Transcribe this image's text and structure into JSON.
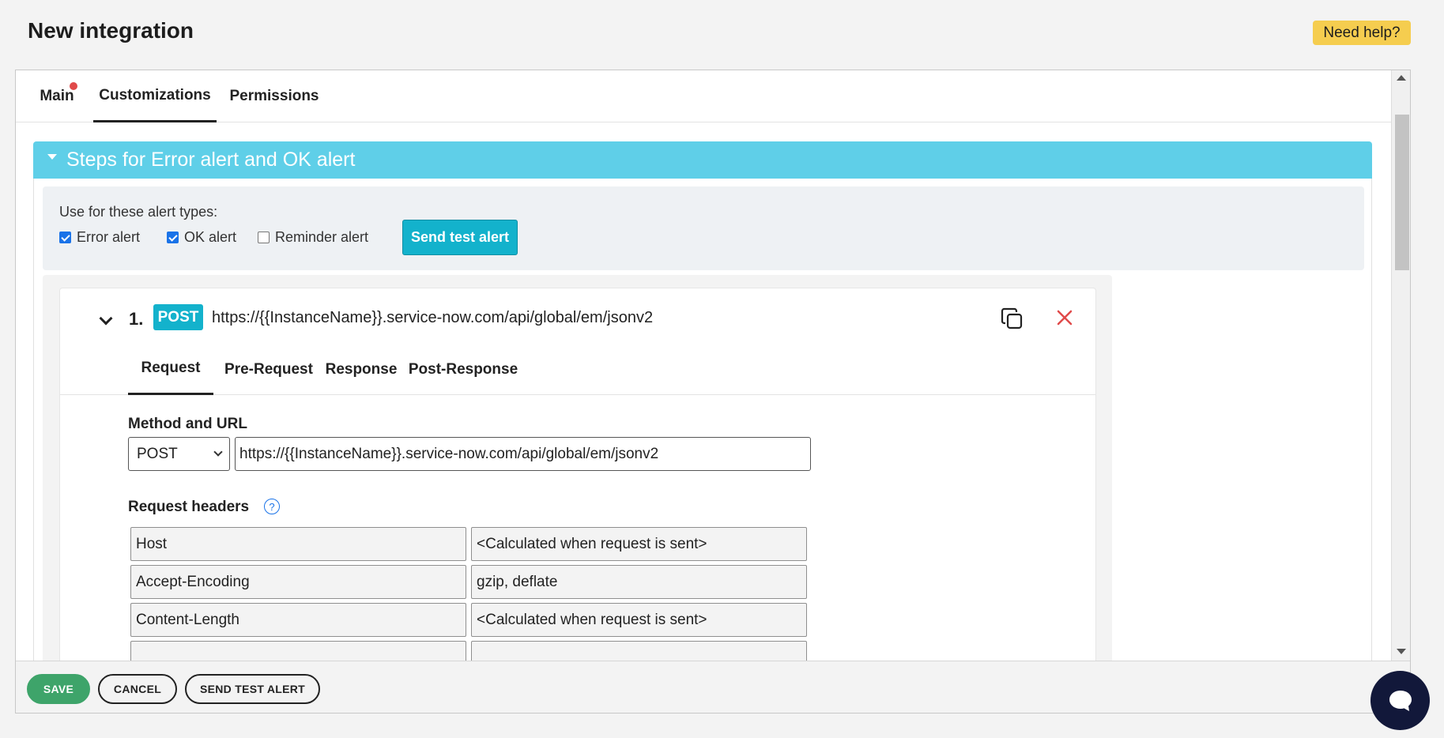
{
  "page": {
    "title": "New integration",
    "help_label": "Need help?"
  },
  "main_tabs": [
    {
      "label": "Main",
      "has_indicator": true
    },
    {
      "label": "Customizations",
      "active": true
    },
    {
      "label": "Permissions"
    }
  ],
  "section": {
    "title": "Steps for Error alert and OK alert",
    "alert_types_label": "Use for these alert types:",
    "alert_types": [
      {
        "label": "Error alert",
        "checked": true
      },
      {
        "label": "OK alert",
        "checked": true
      },
      {
        "label": "Reminder alert",
        "checked": false
      }
    ],
    "send_test_label": "Send test alert"
  },
  "step": {
    "number": "1.",
    "method": "POST",
    "url": "https://{{InstanceName}}.service-now.com/api/global/em/jsonv2",
    "sub_tabs": [
      {
        "label": "Request",
        "active": true
      },
      {
        "label": "Pre-Request"
      },
      {
        "label": "Response"
      },
      {
        "label": "Post-Response"
      }
    ],
    "method_url_label": "Method and URL",
    "method_value": "POST",
    "request_headers_label": "Request headers",
    "request_headers": [
      {
        "name": "Host",
        "value": "<Calculated when request is sent>"
      },
      {
        "name": "Accept-Encoding",
        "value": "gzip, deflate"
      },
      {
        "name": "Content-Length",
        "value": "<Calculated when request is sent>"
      }
    ]
  },
  "footer": {
    "save_label": "SAVE",
    "cancel_label": "CANCEL",
    "send_test_label": "SEND TEST ALERT"
  },
  "icons": {
    "copy": "copy-icon",
    "close": "close-icon",
    "help": "help-circle-icon",
    "chat": "chat-icon"
  },
  "colors": {
    "accent": "#13b2cc",
    "section_header": "#5fcfe8",
    "save": "#3ea46a",
    "help_button": "#f5cd4f",
    "danger": "#e04a4a"
  }
}
